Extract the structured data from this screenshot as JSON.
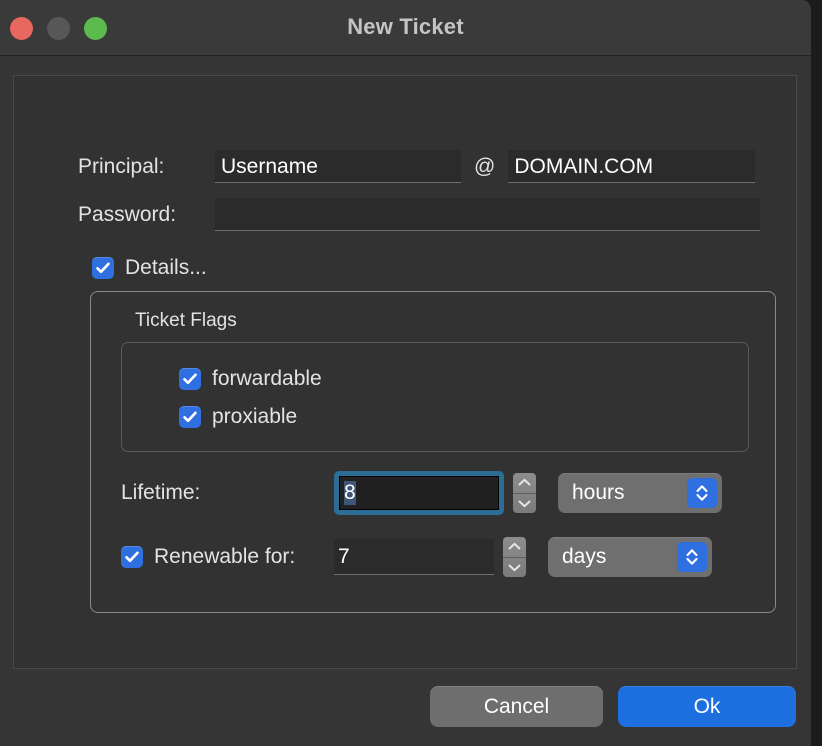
{
  "window": {
    "title": "New Ticket",
    "traffic_lights": [
      {
        "name": "close",
        "color": "#e8675e"
      },
      {
        "name": "minimize",
        "color": "#575757"
      },
      {
        "name": "zoom",
        "color": "#5cba4f"
      }
    ]
  },
  "form": {
    "principal": {
      "label": "Principal:",
      "username_value": "Username",
      "username_placeholder": "",
      "at_separator": "@",
      "realm_value": "DOMAIN.COM",
      "realm_placeholder": ""
    },
    "password": {
      "label": "Password:",
      "value": "",
      "placeholder": ""
    },
    "details_toggle": {
      "label": "Details...",
      "checked": true
    }
  },
  "details": {
    "flags_title": "Ticket Flags",
    "flags": [
      {
        "label": "forwardable",
        "checked": true
      },
      {
        "label": "proxiable",
        "checked": true
      }
    ],
    "lifetime": {
      "label": "Lifetime:",
      "value": "8",
      "unit": "hours",
      "focused": true
    },
    "renewable": {
      "label": "Renewable for:",
      "checked": true,
      "value": "7",
      "unit": "days"
    }
  },
  "buttons": {
    "cancel": "Cancel",
    "ok": "Ok"
  },
  "colors": {
    "accent_blue": "#2f6fe0",
    "default_button_blue": "#1d6fe0",
    "focus_ring": "#2b6d94",
    "window_bg": "#353535",
    "panel_bg": "#323232"
  }
}
